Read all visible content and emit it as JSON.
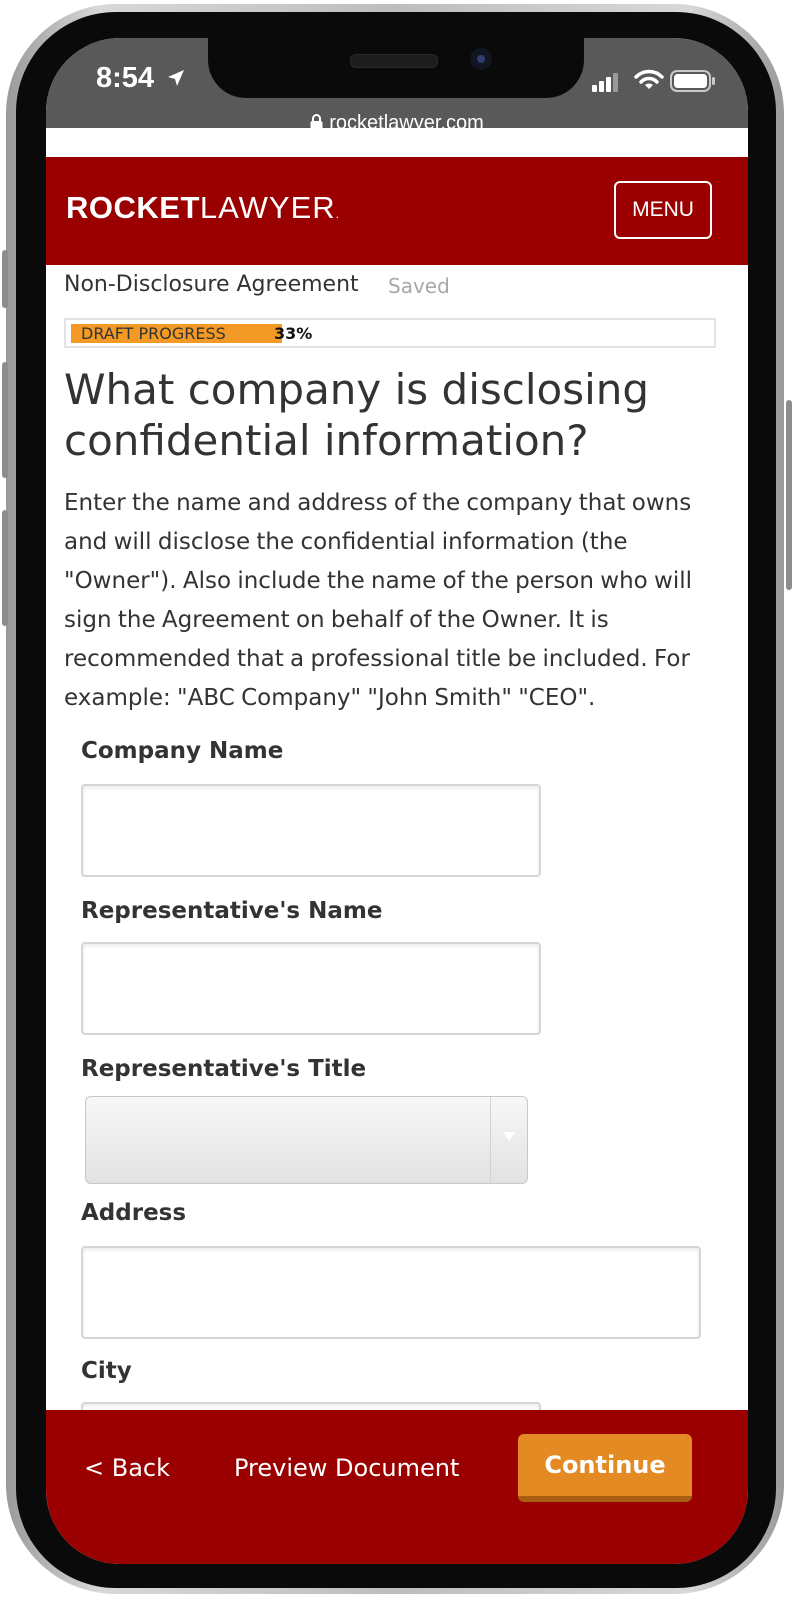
{
  "status_bar": {
    "time": "8:54",
    "url": "rocketlawyer.com"
  },
  "header": {
    "logo_bold": "ROCKET",
    "logo_light": "LAWYER",
    "logo_mark": ".",
    "menu_label": "MENU",
    "brand_color": "#9a0000"
  },
  "doc": {
    "title": "Non-Disclosure Agreement",
    "saved_label": "Saved"
  },
  "progress": {
    "label": "DRAFT PROGRESS",
    "percent_text": "33%",
    "fraction": 0.33,
    "fill_color": "#f39a26"
  },
  "question": {
    "heading": "What company is disclosing confidential information?",
    "description": "Enter the name and address of the company that owns and will disclose the confidential information (the \"Owner\"). Also include the name of the person who will sign the Agreement on behalf of the Owner. It is recommended that a professional title be included. For example: \"ABC Company\" \"John Smith\" \"CEO\"."
  },
  "form": {
    "company_name_label": "Company Name",
    "company_name_value": "",
    "rep_name_label": "Representative's Name",
    "rep_name_value": "",
    "rep_title_label": "Representative's Title",
    "rep_title_value": "",
    "address_label": "Address",
    "address_value": "",
    "city_label": "City",
    "city_value": ""
  },
  "footer": {
    "back_label": "< Back",
    "preview_label": "Preview Document",
    "continue_label": "Continue",
    "accent_color": "#e38a23"
  }
}
